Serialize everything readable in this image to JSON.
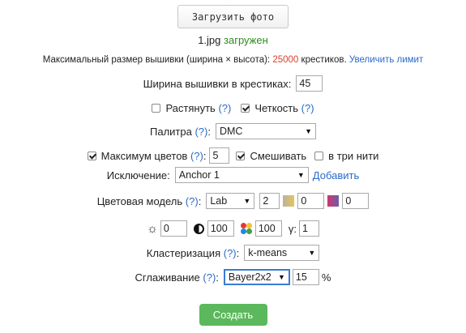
{
  "upload": {
    "label": "Загрузить фото"
  },
  "file_status": {
    "filename": "1.jpg",
    "status": "загружен"
  },
  "limit": {
    "prefix": "Максимальный размер вышивки (ширина × высота):",
    "value": "25000",
    "unit": "крестиков.",
    "link": "Увеличить лимит"
  },
  "width": {
    "label": "Ширина вышивки в крестиках:",
    "value": "45"
  },
  "options": {
    "stretch_label": "Растянуть",
    "stretch_checked": false,
    "sharpness_label": "Четкость",
    "sharpness_checked": true,
    "help": "(?)"
  },
  "palette": {
    "label_start": "Палитра",
    "help": "(?)",
    "label_end": ":",
    "value": "DMC"
  },
  "colors": {
    "max_label": "Максимум цветов",
    "help": "(?)",
    "colon": ":",
    "max_value": "5",
    "max_checked": true,
    "mix_label": "Смешивать",
    "mix_checked": true,
    "three_label": "в три нити",
    "three_checked": false
  },
  "exclusion": {
    "label": "Исключение:",
    "value": "Anchor 1",
    "add": "Добавить"
  },
  "color_model": {
    "label_start": "Цветовая модель",
    "help": "(?)",
    "colon": ":",
    "value": "Lab",
    "n": "2",
    "param1": "0",
    "param2": "0"
  },
  "adjust": {
    "brightness": "0",
    "contrast": "100",
    "saturation": "100",
    "gamma_label": "γ:",
    "gamma": "1"
  },
  "clustering": {
    "label_start": "Кластеризация",
    "help": "(?)",
    "colon": ":",
    "value": "k-means"
  },
  "smoothing": {
    "label_start": "Сглаживание",
    "help": "(?)",
    "colon": ":",
    "value": "Bayer2x2",
    "percent_value": "15",
    "percent_sign": "%"
  },
  "create": {
    "label": "Создать"
  },
  "colors_theme": {
    "accent_green": "#5cb85c",
    "link_blue": "#2a6ac9",
    "limit_red": "#d9412c",
    "status_green": "#2e8b1e"
  }
}
